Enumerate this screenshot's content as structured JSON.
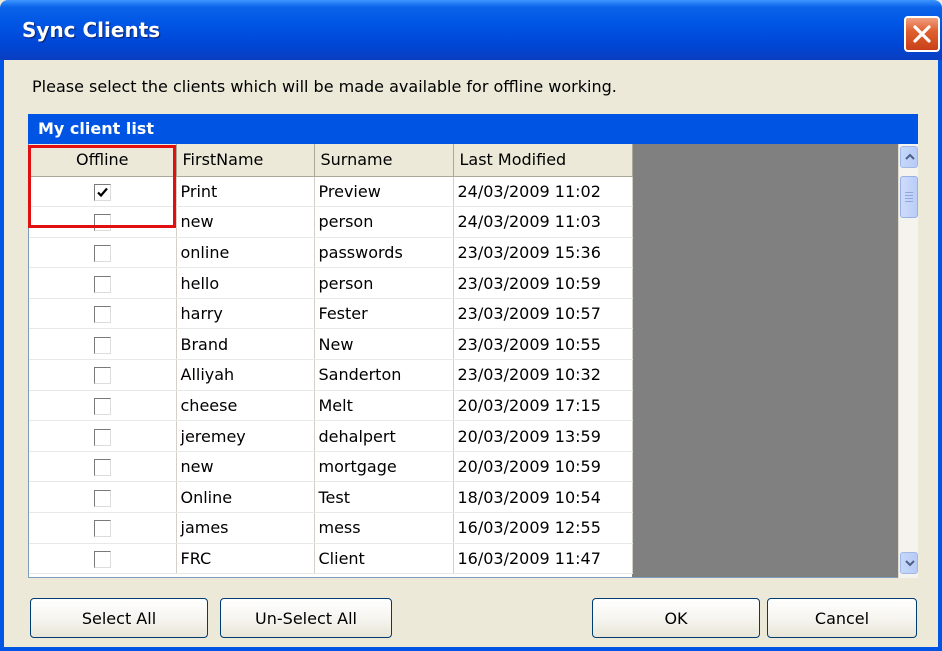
{
  "window": {
    "title": "Sync Clients"
  },
  "instruction": "Please select the clients which will be made available for offline working.",
  "group": {
    "title": "My client list"
  },
  "columns": {
    "offline": "Offline",
    "first_name": "FirstName",
    "surname": "Surname",
    "last_modified": "Last Modified"
  },
  "rows": [
    {
      "offline": true,
      "first_name": "Print",
      "surname": "Preview",
      "last_modified": "24/03/2009 11:02"
    },
    {
      "offline": false,
      "first_name": "new",
      "surname": "person",
      "last_modified": "24/03/2009 11:03"
    },
    {
      "offline": false,
      "first_name": "online",
      "surname": "passwords",
      "last_modified": "23/03/2009 15:36"
    },
    {
      "offline": false,
      "first_name": "hello",
      "surname": "person",
      "last_modified": "23/03/2009 10:59"
    },
    {
      "offline": false,
      "first_name": "harry",
      "surname": "Fester",
      "last_modified": "23/03/2009 10:57"
    },
    {
      "offline": false,
      "first_name": "Brand",
      "surname": "New",
      "last_modified": "23/03/2009 10:55"
    },
    {
      "offline": false,
      "first_name": "Alliyah",
      "surname": "Sanderton",
      "last_modified": "23/03/2009 10:32"
    },
    {
      "offline": false,
      "first_name": "cheese",
      "surname": "Melt",
      "last_modified": "20/03/2009 17:15"
    },
    {
      "offline": false,
      "first_name": "jeremey",
      "surname": "dehalpert",
      "last_modified": "20/03/2009 13:59"
    },
    {
      "offline": false,
      "first_name": "new",
      "surname": "mortgage",
      "last_modified": "20/03/2009 10:59"
    },
    {
      "offline": false,
      "first_name": "Online",
      "surname": "Test",
      "last_modified": "18/03/2009 10:54"
    },
    {
      "offline": false,
      "first_name": "james",
      "surname": "mess",
      "last_modified": "16/03/2009 12:55"
    },
    {
      "offline": false,
      "first_name": "FRC",
      "surname": "Client",
      "last_modified": "16/03/2009 11:47"
    }
  ],
  "buttons": {
    "select_all": "Select All",
    "unselect_all": "Un-Select All",
    "ok": "OK",
    "cancel": "Cancel"
  },
  "colors": {
    "title_bar": "#0055e5",
    "group_header": "#0054e3",
    "highlight": "#e01010",
    "grid_empty": "#808080"
  },
  "icons": {
    "close": "close-icon",
    "check": "check-icon",
    "scroll_up": "chevron-up-icon",
    "scroll_down": "chevron-down-icon"
  }
}
